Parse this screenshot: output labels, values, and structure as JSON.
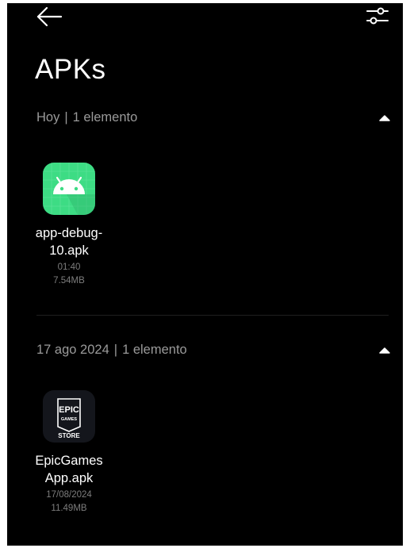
{
  "header": {
    "back_icon": "arrow-left-icon",
    "filter_icon": "sliders-icon",
    "title": "APKs"
  },
  "sections": [
    {
      "date": "Hoy",
      "separator": "|",
      "count": "1 elemento",
      "collapse_icon": "triangle-up-icon",
      "files": [
        {
          "icon": "android-apk-icon",
          "name_line1": "app-debug-",
          "name_line2": "10.apk",
          "time": "01:40",
          "size": "7.54MB"
        }
      ]
    },
    {
      "date": "17 ago 2024",
      "separator": "|",
      "count": "1 elemento",
      "collapse_icon": "triangle-up-icon",
      "files": [
        {
          "icon": "epic-games-store-icon",
          "logo_text": {
            "top": "EPIC",
            "middle": "GAMES",
            "bottom": "STORE"
          },
          "name_line1": "EpicGames",
          "name_line2": "App.apk",
          "time": "17/08/2024",
          "size": "11.49MB"
        }
      ]
    }
  ],
  "colors": {
    "background": "#000000",
    "android_green": "#3ddc84",
    "epic_bg": "#14161c",
    "secondary_text": "#9a9a9a"
  }
}
